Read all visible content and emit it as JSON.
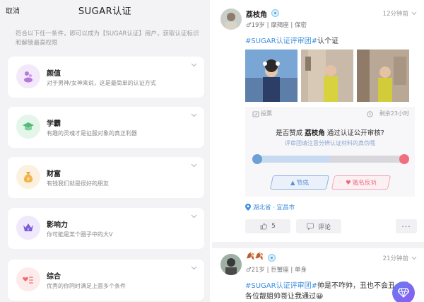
{
  "left": {
    "cancel": "取消",
    "title": "SUGAR认证",
    "intro": "符合以下任一条件，即可以成为【SUGAR认证】用户，获取认证标识和解锁最高权限",
    "cards": [
      {
        "icon": "face-icon",
        "title": "颜值",
        "desc": "对于男神/女神来说，这是最简单的认证方式",
        "color": "#f3e9fb"
      },
      {
        "icon": "graduation-cap-icon",
        "title": "学霸",
        "desc": "有趣的灵魂才是征服对象的真正利器",
        "color": "#e4f5ea"
      },
      {
        "icon": "money-bag-icon",
        "title": "财富",
        "desc": "有钱我们就是很好的朋友",
        "color": "#fcf1df"
      },
      {
        "icon": "crown-icon",
        "title": "影响力",
        "desc": "你可能是某个圈子中的大V",
        "color": "#efe9fb"
      },
      {
        "icon": "heart-list-icon",
        "title": "综合",
        "desc": "优秀的你同时满足上面多个条件",
        "color": "#fdeaea"
      }
    ]
  },
  "post1": {
    "name": "荔枝角",
    "time": "12分钟前",
    "meta": "♂19岁 | 摩羯座 | 保密",
    "hashtag": "#SUGAR认证评审团#",
    "text": "认个证",
    "vote_label": "投票",
    "vote_remaining": "剩余23小时",
    "vote_question_prefix": "是否赞成 ",
    "vote_question_name": "荔枝角",
    "vote_question_suffix": " 通过认证公开审核?",
    "vote_sub": "评审团请注意分辨认证材料的真伪哦",
    "vote_yes": "赞成",
    "vote_no": "匿名反对",
    "location": "湖北省 · 宜昌市",
    "likes": "5",
    "comment": "评论"
  },
  "post2": {
    "name": "🍂🍂",
    "time": "21分钟前",
    "meta": "♂21岁 | 巨蟹座 | 单身",
    "hashtag": "#SUGAR认证评审团#",
    "text": "帅是不咋帅，丑也不会丑，我",
    "line2": "各位靓姐帅哥让我通过😀"
  },
  "colors": {
    "accent": "#3d8fe0",
    "yes": "#5c8fd1",
    "no": "#e66a80"
  }
}
